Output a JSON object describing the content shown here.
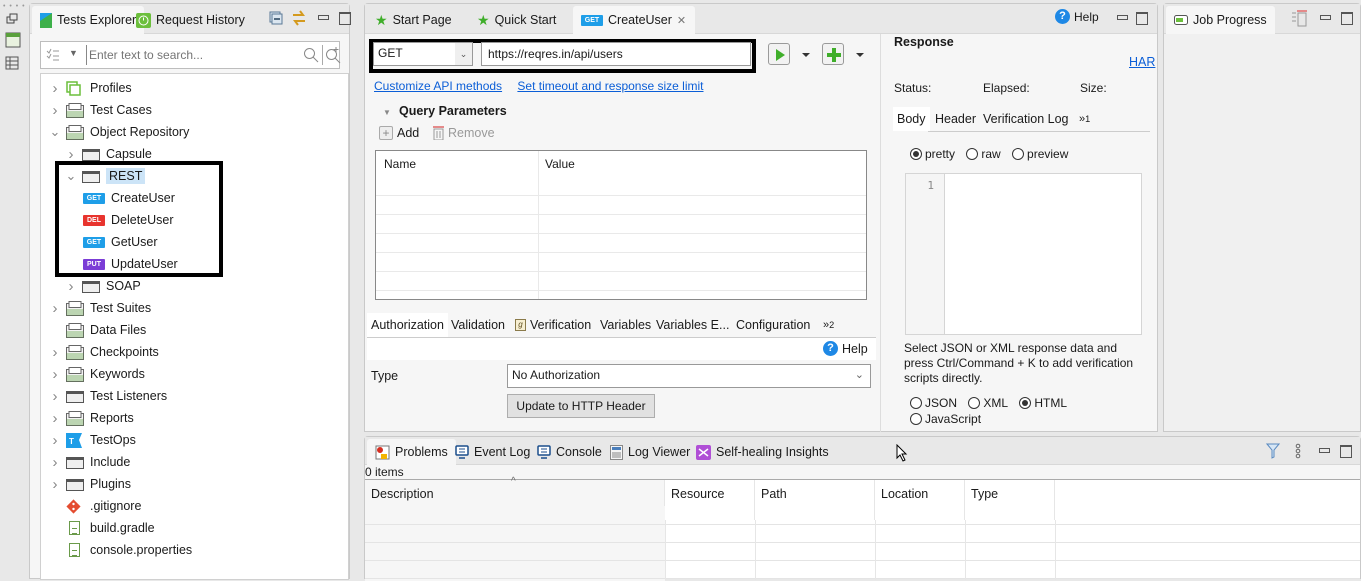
{
  "trim": {
    "icons": [
      "restore-icon",
      "keywords-icon",
      "table-icon"
    ]
  },
  "explorer": {
    "tabs": [
      {
        "label": "Tests Explorer",
        "icon": "tests-explorer-icon",
        "active": true
      },
      {
        "label": "Request History",
        "icon": "request-history-icon",
        "active": false
      }
    ],
    "search_placeholder": "Enter text to search...",
    "tree": [
      {
        "label": "Profiles",
        "icon": "profiles-icon",
        "expand": "collapsed",
        "level": 0
      },
      {
        "label": "Test Cases",
        "icon": "test-cases-icon",
        "expand": "collapsed",
        "level": 0
      },
      {
        "label": "Object Repository",
        "icon": "object-repository-icon",
        "expand": "expanded",
        "level": 0
      },
      {
        "label": "Capsule",
        "icon": "folder-icon",
        "expand": "collapsed",
        "level": 1
      },
      {
        "label": "REST",
        "icon": "folder-icon",
        "expand": "expanded",
        "level": 1,
        "selected": true
      },
      {
        "label": "CreateUser",
        "badge": "GET",
        "level": 2
      },
      {
        "label": "DeleteUser",
        "badge": "DEL",
        "level": 2
      },
      {
        "label": "GetUser",
        "badge": "GET",
        "level": 2
      },
      {
        "label": "UpdateUser",
        "badge": "PUT",
        "level": 2
      },
      {
        "label": "SOAP",
        "icon": "folder-icon",
        "expand": "collapsed",
        "level": 1
      },
      {
        "label": "Test Suites",
        "icon": "test-suites-icon",
        "expand": "collapsed",
        "level": 0
      },
      {
        "label": "Data Files",
        "icon": "data-files-icon",
        "expand": "none",
        "level": 0
      },
      {
        "label": "Checkpoints",
        "icon": "checkpoints-icon",
        "expand": "collapsed",
        "level": 0
      },
      {
        "label": "Keywords",
        "icon": "keywords-icon",
        "expand": "collapsed",
        "level": 0
      },
      {
        "label": "Test Listeners",
        "icon": "folder-icon",
        "expand": "collapsed",
        "level": 0
      },
      {
        "label": "Reports",
        "icon": "reports-icon",
        "expand": "collapsed",
        "level": 0
      },
      {
        "label": "TestOps",
        "icon": "testops-icon",
        "expand": "collapsed",
        "level": 0
      },
      {
        "label": "Include",
        "icon": "folder-icon",
        "expand": "collapsed",
        "level": 0
      },
      {
        "label": "Plugins",
        "icon": "folder-icon",
        "expand": "collapsed",
        "level": 0
      },
      {
        "label": ".gitignore",
        "icon": "git-icon",
        "expand": "none",
        "level": 0
      },
      {
        "label": "build.gradle",
        "icon": "file-icon",
        "expand": "none",
        "level": 0
      },
      {
        "label": "console.properties",
        "icon": "file-icon",
        "expand": "none",
        "level": 0
      }
    ]
  },
  "editor": {
    "tabs": [
      {
        "label": "Start Page",
        "icon": "star-icon"
      },
      {
        "label": "Quick Start",
        "icon": "star-icon"
      },
      {
        "label": "CreateUser",
        "badge": "GET",
        "active": true,
        "closable": true
      }
    ],
    "help_label": "Help",
    "method": "GET",
    "url": "https://reqres.in/api/users",
    "links": {
      "customize": "Customize API methods",
      "timeout": "Set timeout and response size limit"
    },
    "query_params": {
      "title": "Query Parameters",
      "add_label": "Add",
      "remove_label": "Remove",
      "columns": [
        "Name",
        "Value"
      ],
      "rows": []
    },
    "subtabs": [
      "Authorization",
      "Validation",
      "Verification",
      "Variables",
      "Variables E...",
      "Configuration"
    ],
    "subtabs_overflow": "2",
    "auth": {
      "help_label": "Help",
      "type_label": "Type",
      "type_value": "No Authorization",
      "update_button": "Update to HTTP Header"
    },
    "response": {
      "title": "Response",
      "har_link": "HAR",
      "status_label": "Status:",
      "elapsed_label": "Elapsed:",
      "size_label": "Size:",
      "tabs": [
        "Body",
        "Header",
        "Verification Log"
      ],
      "tabs_overflow": "1",
      "view_modes": [
        {
          "label": "pretty",
          "selected": true
        },
        {
          "label": "raw",
          "selected": false
        },
        {
          "label": "preview",
          "selected": false
        }
      ],
      "line_number": "1",
      "hint": "Select JSON or XML response data and press Ctrl/Command + K to add verification scripts directly.",
      "formats": [
        {
          "label": "JSON",
          "selected": false
        },
        {
          "label": "XML",
          "selected": false
        },
        {
          "label": "HTML",
          "selected": true
        },
        {
          "label": "JavaScript",
          "selected": false
        }
      ]
    }
  },
  "jobs": {
    "tab_label": "Job Progress"
  },
  "problems": {
    "tabs": [
      {
        "label": "Problems",
        "icon": "problems-icon",
        "active": true
      },
      {
        "label": "Event Log",
        "icon": "event-log-icon"
      },
      {
        "label": "Console",
        "icon": "console-icon"
      },
      {
        "label": "Log Viewer",
        "icon": "log-viewer-icon"
      },
      {
        "label": "Self-healing Insights",
        "icon": "self-healing-icon"
      }
    ],
    "count": "0 items",
    "columns": [
      "Description",
      "Resource",
      "Path",
      "Location",
      "Type"
    ]
  },
  "colors": {
    "get": "#1e9ee8",
    "del": "#e8342e",
    "put": "#7b3cd6",
    "link": "#0b5ed7",
    "run": "#3fae2a"
  }
}
